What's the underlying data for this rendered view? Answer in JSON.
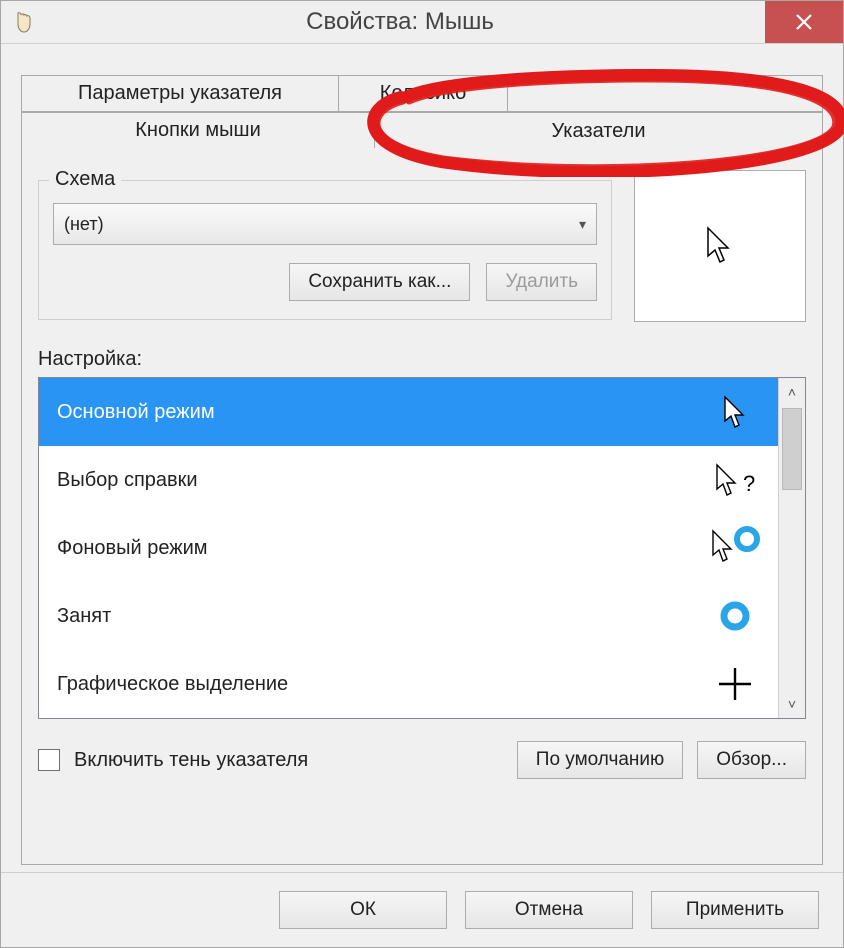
{
  "window": {
    "title": "Свойства: Мышь",
    "close_symbol": "×"
  },
  "tabs": {
    "row1": [
      "Параметры указателя",
      "Колесико",
      ""
    ],
    "row2": [
      "Кнопки мыши",
      "Указатели"
    ]
  },
  "scheme": {
    "legend": "Схема",
    "value": "(нет)",
    "save_as": "Сохранить как...",
    "delete": "Удалить"
  },
  "customize": {
    "label": "Настройка:",
    "items": [
      {
        "label": "Основной режим",
        "icon": "cursor-arrow",
        "selected": true
      },
      {
        "label": "Выбор справки",
        "icon": "cursor-help",
        "selected": false
      },
      {
        "label": "Фоновый режим",
        "icon": "cursor-busy-bg",
        "selected": false
      },
      {
        "label": "Занят",
        "icon": "busy-ring",
        "selected": false
      },
      {
        "label": "Графическое выделение",
        "icon": "crosshair",
        "selected": false
      }
    ]
  },
  "options": {
    "shadow_label": "Включить тень указателя",
    "defaults": "По умолчанию",
    "browse": "Обзор..."
  },
  "footer": {
    "ok": "ОК",
    "cancel": "Отмена",
    "apply": "Применить"
  }
}
